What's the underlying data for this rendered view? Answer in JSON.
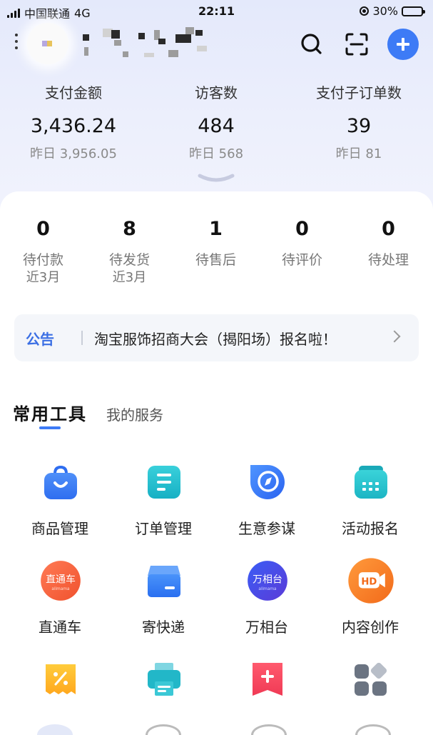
{
  "status_bar": {
    "carrier": "中国联通",
    "network": "4G",
    "time": "22:11",
    "battery": "30%"
  },
  "stats": [
    {
      "label": "支付金额",
      "value": "3,436.24",
      "previous": "昨日 3,956.05"
    },
    {
      "label": "访客数",
      "value": "484",
      "previous": "昨日 568"
    },
    {
      "label": "支付子订单数",
      "value": "39",
      "previous": "昨日 81"
    }
  ],
  "orders": [
    {
      "count": "0",
      "label": "待付款",
      "sub": "近3月"
    },
    {
      "count": "8",
      "label": "待发货",
      "sub": "近3月"
    },
    {
      "count": "1",
      "label": "待售后",
      "sub": ""
    },
    {
      "count": "0",
      "label": "待评价",
      "sub": ""
    },
    {
      "count": "0",
      "label": "待处理",
      "sub": ""
    }
  ],
  "notice": {
    "tag": "公告",
    "text": "淘宝服饰招商大会（揭阳场）报名啦！"
  },
  "tabs": {
    "active": "常用工具",
    "inactive": "我的服务"
  },
  "tools": [
    {
      "label": "商品管理",
      "icon": "shopping-bag-icon"
    },
    {
      "label": "订单管理",
      "icon": "order-list-icon"
    },
    {
      "label": "生意参谋",
      "icon": "compass-icon"
    },
    {
      "label": "活动报名",
      "icon": "activity-signup-icon"
    },
    {
      "label": "直通车",
      "icon": "ztc-badge-icon",
      "badge": "直通车"
    },
    {
      "label": "寄快递",
      "icon": "express-box-icon"
    },
    {
      "label": "万相台",
      "icon": "wanxiangtai-badge-icon",
      "badge": "万相台"
    },
    {
      "label": "内容创作",
      "icon": "hd-video-icon",
      "badge": "HD"
    },
    {
      "label": "",
      "icon": "coupon-percent-icon"
    },
    {
      "label": "",
      "icon": "printer-icon"
    },
    {
      "label": "",
      "icon": "red-packet-plus-icon"
    },
    {
      "label": "",
      "icon": "grid-apps-icon"
    }
  ],
  "colors": {
    "accent": "#3d7bf6",
    "notice_tag": "#3b6fe4"
  }
}
